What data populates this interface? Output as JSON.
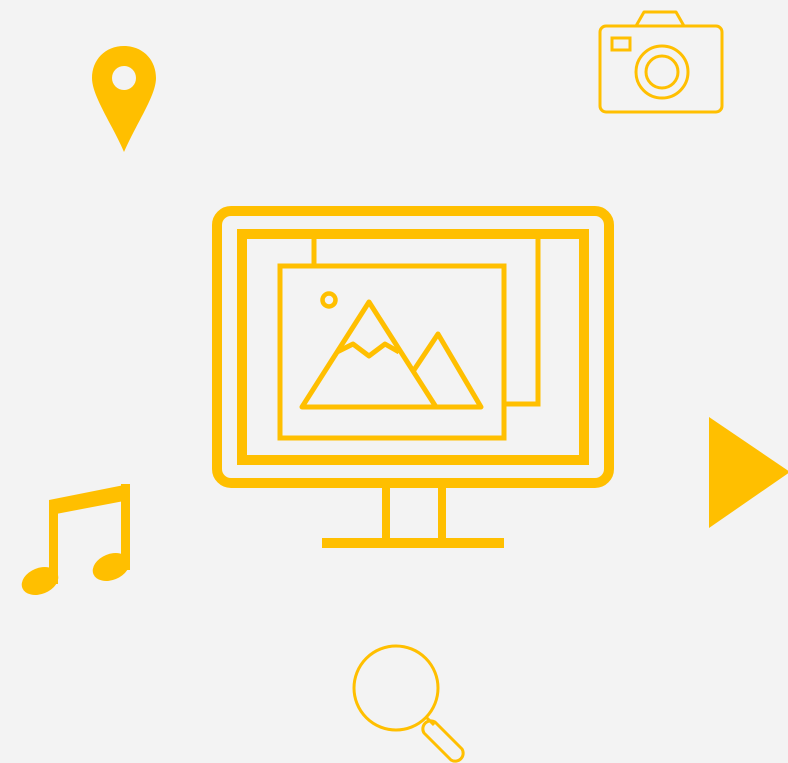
{
  "theme": {
    "background": "#f3f3f3",
    "accent": "#ffbf00"
  },
  "icons": [
    {
      "name": "location-pin-icon"
    },
    {
      "name": "camera-icon"
    },
    {
      "name": "monitor-image-icon"
    },
    {
      "name": "music-note-icon"
    },
    {
      "name": "play-icon"
    },
    {
      "name": "magnifier-icon"
    }
  ]
}
